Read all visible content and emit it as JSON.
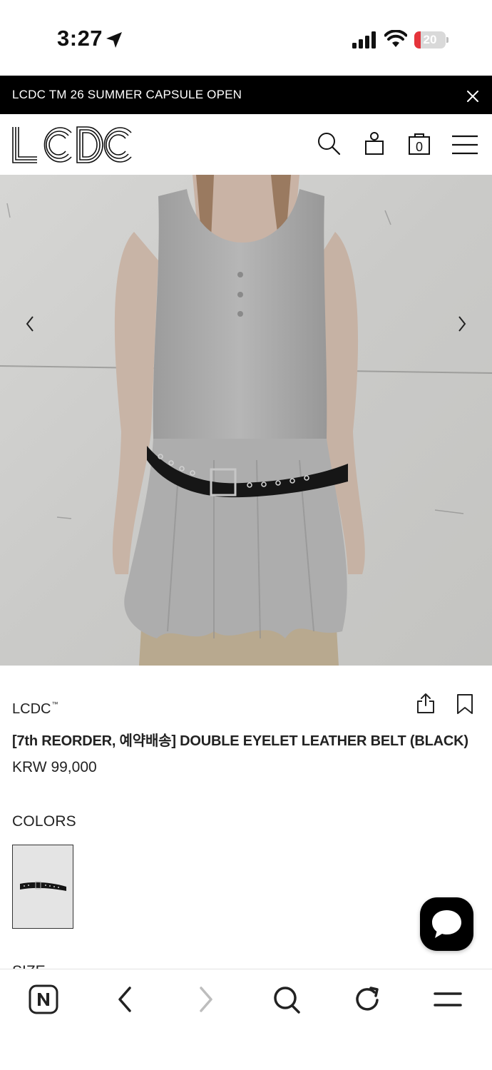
{
  "status_bar": {
    "time": "3:27",
    "battery_level": "20",
    "battery_fraction": 0.2,
    "battery_color": "#e5343b",
    "icons": [
      "location-arrow-icon",
      "signal-icon",
      "wifi-icon",
      "battery-icon"
    ]
  },
  "announcement": {
    "text": "LCDC TM 26 SUMMER CAPSULE OPEN",
    "close_icon": "close-icon",
    "background": "#000000"
  },
  "header": {
    "logo_text": "LCDC",
    "cart_count": "0",
    "icons": [
      "search-icon",
      "shopping-bag-icon",
      "cart-icon",
      "menu-icon"
    ]
  },
  "hero": {
    "prev_icon": "chevron-left-icon",
    "next_icon": "chevron-right-icon"
  },
  "product": {
    "brand": "LCDC",
    "brand_mark": "™",
    "title": "[7th REORDER, 예약배송] DOUBLE EYELET LEATHER BELT (BLACK)",
    "price": "KRW 99,000",
    "share_icon": "share-icon",
    "bookmark_icon": "bookmark-icon"
  },
  "options": {
    "colors_label": "COLORS",
    "size_label": "SIZE"
  },
  "chat": {
    "icon": "chat-bubble-icon"
  },
  "browser_toolbar": {
    "icons": [
      "naver-home-icon",
      "back-icon",
      "forward-icon",
      "search-icon",
      "reload-icon",
      "menu-icon"
    ]
  }
}
